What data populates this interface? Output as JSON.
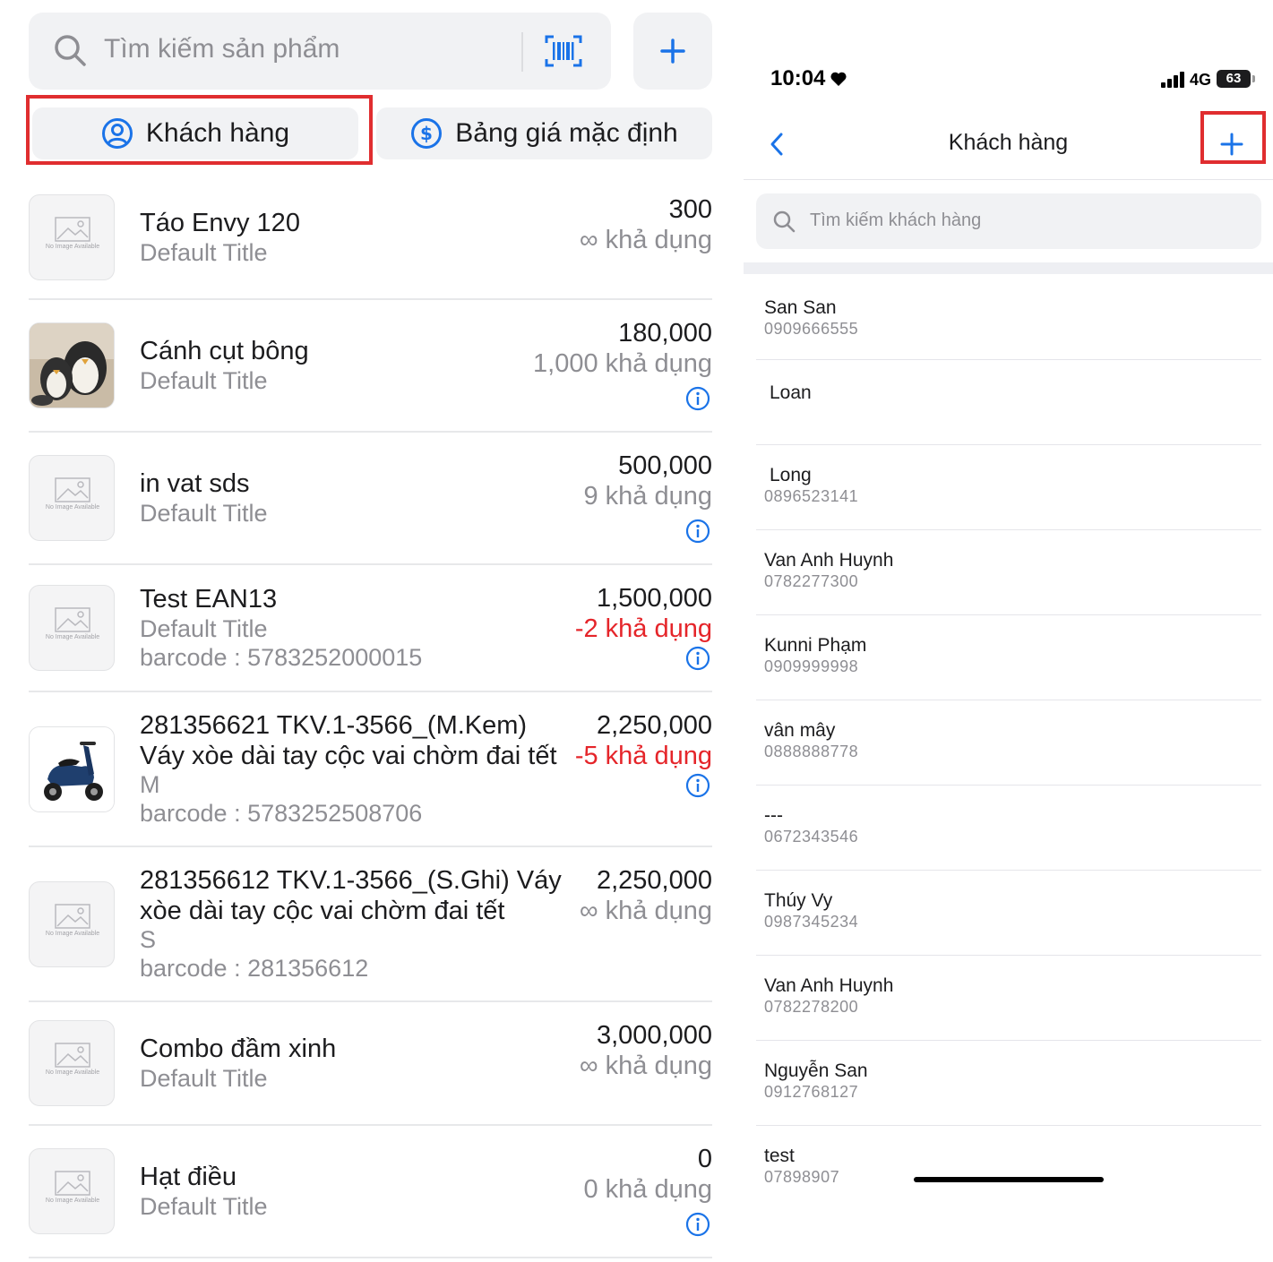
{
  "colors": {
    "accent": "#1a73e8",
    "negative": "#e5252a",
    "highlight": "#e02d2f"
  },
  "left": {
    "search": {
      "placeholder": "Tìm kiếm sản phẩm",
      "icon": "search-icon",
      "scan_icon": "barcode-scan-icon"
    },
    "add_icon": "plus-icon",
    "chips": {
      "customer": "Khách hàng",
      "price_list": "Bảng giá mặc định"
    },
    "no_image_text": "No Image Available",
    "products": [
      {
        "name": "Táo Envy 120",
        "variant": "Default Title",
        "price": "300",
        "stock": "∞ khả dụng",
        "negative": false,
        "image": "no-image",
        "info": false
      },
      {
        "name": "Cánh cụt bông",
        "variant": "Default Title",
        "price": "180,000",
        "stock": "1,000 khả dụng",
        "negative": false,
        "image": "penguin-plush-photo",
        "info": true
      },
      {
        "name": "in vat sds",
        "variant": "Default Title",
        "price": "500,000",
        "stock": "9 khả dụng",
        "negative": false,
        "image": "no-image",
        "info": true
      },
      {
        "name": "Test EAN13",
        "variant": "Default Title",
        "barcode": "barcode : 5783252000015",
        "price": "1,500,000",
        "stock": "-2 khả dụng",
        "negative": true,
        "image": "no-image",
        "info": true
      },
      {
        "name": "281356621 TKV.1-3566_(M.Kem)",
        "name2": "Váy xòe dài tay cộc vai chờm đai tết",
        "variant": "M",
        "barcode": "barcode : 5783252508706",
        "price": "2,250,000",
        "stock": "-5 khả dụng",
        "negative": true,
        "image": "blue-scooter-photo",
        "info": true
      },
      {
        "name": "281356612 TKV.1-3566_(S.Ghi) Váy",
        "name2": "xòe dài tay cộc vai chờm đai tết",
        "variant": "S",
        "barcode": "barcode : 281356612",
        "price": "2,250,000",
        "stock": "∞ khả dụng",
        "negative": false,
        "image": "no-image",
        "info": false
      },
      {
        "name": "Combo đầm xinh",
        "variant": "Default Title",
        "price": "3,000,000",
        "stock": "∞ khả dụng",
        "negative": false,
        "image": "no-image",
        "info": false
      },
      {
        "name": "Hạt điều",
        "variant": "Default Title",
        "price": "0",
        "stock": "0 khả dụng",
        "negative": false,
        "image": "no-image",
        "info": true
      }
    ]
  },
  "right": {
    "status": {
      "time": "10:04",
      "network": "4G",
      "battery": "63"
    },
    "nav": {
      "title": "Khách hàng",
      "back_icon": "chevron-left-icon",
      "add_icon": "plus-icon"
    },
    "search": {
      "placeholder": "Tìm kiếm khách hàng"
    },
    "customers": [
      {
        "name": "San San",
        "phone": "0909666555"
      },
      {
        "name": "Loan",
        "phone": ""
      },
      {
        "name": "Long",
        "phone": "0896523141"
      },
      {
        "name": "Van Anh Huynh",
        "phone": "0782277300"
      },
      {
        "name": "Kunni Phạm",
        "phone": "0909999998"
      },
      {
        "name": "vân mây",
        "phone": "0888888778"
      },
      {
        "name": "---",
        "phone": "0672343546"
      },
      {
        "name": "Thúy Vy",
        "phone": "0987345234"
      },
      {
        "name": "Van Anh Huynh",
        "phone": "0782278200"
      },
      {
        "name": "Nguyễn San",
        "phone": "0912768127"
      },
      {
        "name": "test",
        "phone": "07898907"
      }
    ]
  }
}
